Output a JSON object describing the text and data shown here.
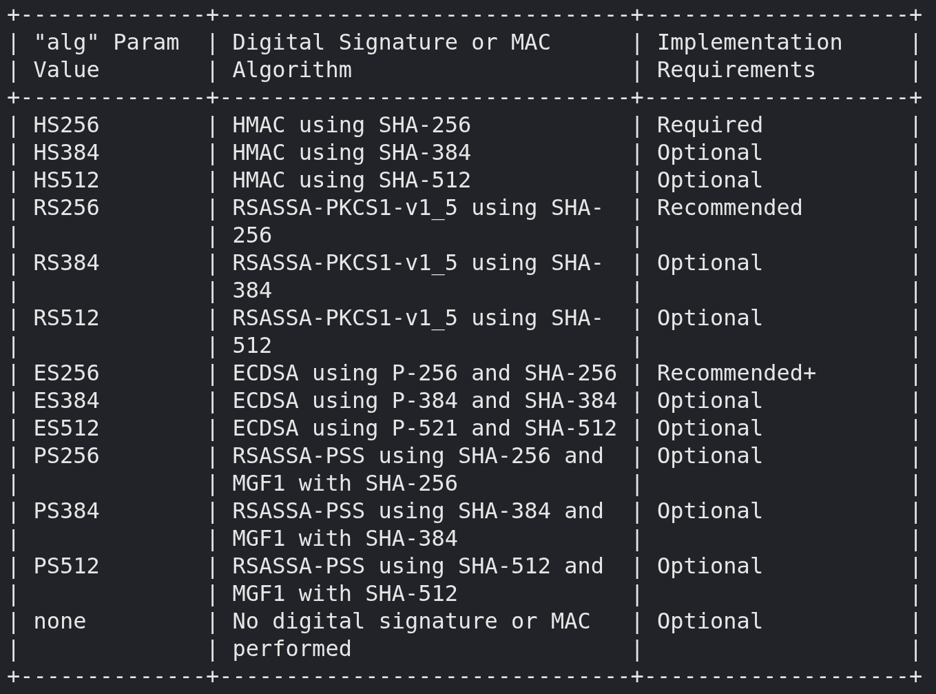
{
  "border": {
    "corner": "+",
    "horizontal": "-",
    "vertical": "|"
  },
  "table": {
    "columns": [
      [
        "\"alg\" Param Value"
      ],
      [
        "Digital Signature or MAC Algorithm"
      ],
      [
        "Implementation Requirements"
      ]
    ],
    "rows": [
      {
        "alg": "HS256",
        "algorithm": "HMAC using SHA-256",
        "requirement": "Required"
      },
      {
        "alg": "HS384",
        "algorithm": "HMAC using SHA-384",
        "requirement": "Optional"
      },
      {
        "alg": "HS512",
        "algorithm": "HMAC using SHA-512",
        "requirement": "Optional"
      },
      {
        "alg": "RS256",
        "algorithm": "RSASSA-PKCS1-v1_5 using SHA-256",
        "requirement": "Recommended"
      },
      {
        "alg": "RS384",
        "algorithm": "RSASSA-PKCS1-v1_5 using SHA-384",
        "requirement": "Optional"
      },
      {
        "alg": "RS512",
        "algorithm": "RSASSA-PKCS1-v1_5 using SHA-512",
        "requirement": "Optional"
      },
      {
        "alg": "ES256",
        "algorithm": "ECDSA using P-256 and SHA-256",
        "requirement": "Recommended+"
      },
      {
        "alg": "ES384",
        "algorithm": "ECDSA using P-384 and SHA-384",
        "requirement": "Optional"
      },
      {
        "alg": "ES512",
        "algorithm": "ECDSA using P-521 and SHA-512",
        "requirement": "Optional"
      },
      {
        "alg": "PS256",
        "algorithm": "RSASSA-PSS using SHA-256 and MGF1 with SHA-256",
        "requirement": "Optional"
      },
      {
        "alg": "PS384",
        "algorithm": "RSASSA-PSS using SHA-384 and MGF1 with SHA-384",
        "requirement": "Optional"
      },
      {
        "alg": "PS512",
        "algorithm": "RSASSA-PSS using SHA-512 and MGF1 with SHA-512",
        "requirement": "Optional"
      },
      {
        "alg": "none",
        "algorithm": "No digital signature or MAC performed",
        "requirement": "Optional"
      }
    ]
  }
}
